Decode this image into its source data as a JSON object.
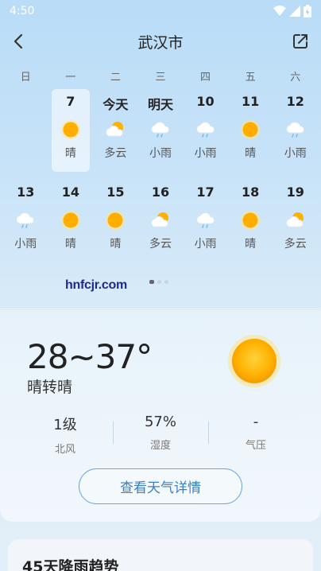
{
  "status_bar": {
    "time": "4:50"
  },
  "header": {
    "title": "武汉市"
  },
  "weekdays": [
    "日",
    "一",
    "二",
    "三",
    "四",
    "五",
    "六"
  ],
  "calendar_rows": [
    [
      {
        "date": "",
        "condition": "",
        "icon": ""
      },
      {
        "date": "7",
        "condition": "晴",
        "icon": "sun-icon",
        "selected": true
      },
      {
        "date": "今天",
        "condition": "多云",
        "icon": "partly-cloudy-icon"
      },
      {
        "date": "明天",
        "condition": "小雨",
        "icon": "light-rain-icon"
      },
      {
        "date": "10",
        "condition": "小雨",
        "icon": "light-rain-icon"
      },
      {
        "date": "11",
        "condition": "晴",
        "icon": "sun-icon"
      },
      {
        "date": "12",
        "condition": "小雨",
        "icon": "light-rain-icon"
      }
    ],
    [
      {
        "date": "13",
        "condition": "小雨",
        "icon": "light-rain-icon"
      },
      {
        "date": "14",
        "condition": "晴",
        "icon": "sun-icon"
      },
      {
        "date": "15",
        "condition": "晴",
        "icon": "sun-icon"
      },
      {
        "date": "16",
        "condition": "多云",
        "icon": "partly-cloudy-icon"
      },
      {
        "date": "17",
        "condition": "小雨",
        "icon": "light-rain-icon"
      },
      {
        "date": "18",
        "condition": "晴",
        "icon": "sun-icon"
      },
      {
        "date": "19",
        "condition": "多云",
        "icon": "partly-cloudy-icon"
      }
    ]
  ],
  "watermark": "hnfcjr.com",
  "current": {
    "temp_range": "28~37°",
    "description": "晴转晴",
    "icon": "sun-icon"
  },
  "stats": [
    {
      "value": "1级",
      "label": "北风"
    },
    {
      "value": "57%",
      "label": "湿度"
    },
    {
      "value": "-",
      "label": "气压"
    }
  ],
  "detail_button": "查看天气详情",
  "rain_trend": {
    "title": "45天降雨趋势"
  },
  "colors": {
    "accent": "#3a7fc0",
    "sun": "#ffb300"
  }
}
